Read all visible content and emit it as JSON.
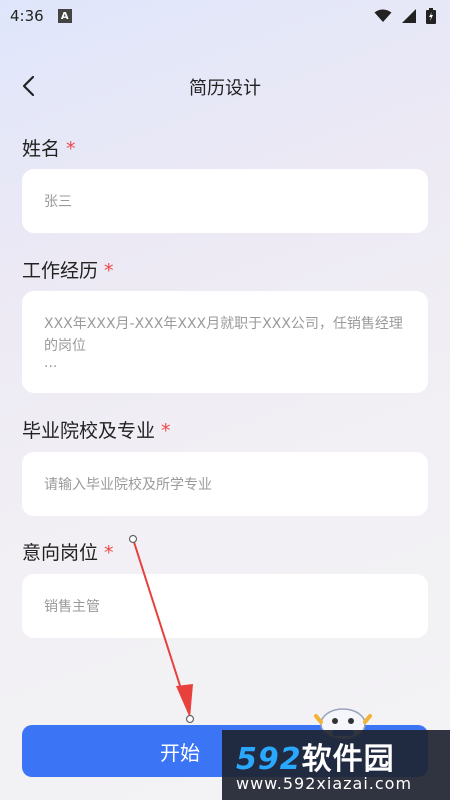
{
  "status_bar": {
    "time": "4:36",
    "notification_icon": "A"
  },
  "nav": {
    "title": "简历设计",
    "back_icon": "chevron-left-icon"
  },
  "form": {
    "name": {
      "label": "姓名",
      "required_mark": "*",
      "value": "张三"
    },
    "work_experience": {
      "label": "工作经历",
      "required_mark": "*",
      "line1": "XXX年XXX月-XXX年XXX月就职于XXX公司，任销售经理",
      "line2": "的岗位",
      "line3": "..."
    },
    "education": {
      "label": "毕业院校及专业",
      "required_mark": "*",
      "placeholder": "请输入毕业院校及所学专业"
    },
    "position": {
      "label": "意向岗位",
      "required_mark": "*",
      "value": "销售主管"
    }
  },
  "submit": {
    "label": "开始"
  },
  "watermark": {
    "digits": "592",
    "text": "软件园",
    "url": "www.592xiazai.com"
  },
  "colors": {
    "accent": "#3b75f5",
    "required": "#f04848",
    "annotation": "#e8403c"
  }
}
